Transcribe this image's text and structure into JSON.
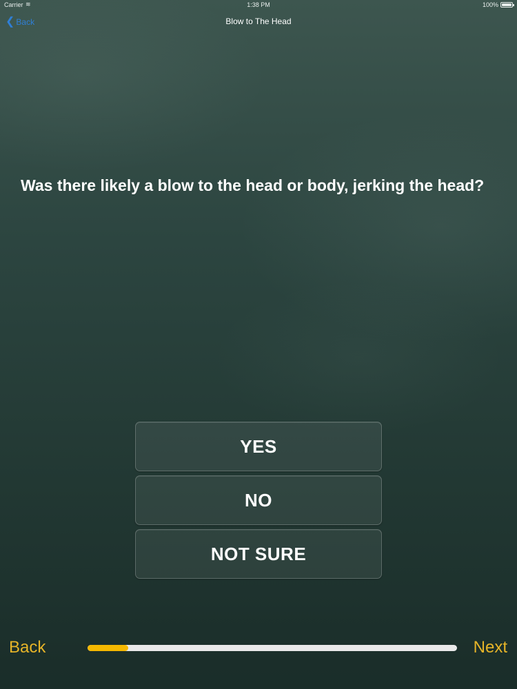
{
  "status_bar": {
    "carrier": "Carrier",
    "wifi_icon": "wifi-icon",
    "time": "1:38 PM",
    "battery_level": "100%",
    "battery_icon": "battery-icon"
  },
  "nav": {
    "back_label": "Back",
    "back_icon": "chevron-left-icon",
    "title": "Blow to The Head",
    "accent_color": "#2f7fd6"
  },
  "question": {
    "text": "Was there likely a blow to the head or body, jerking the head?"
  },
  "answers": {
    "yes": "YES",
    "no": "NO",
    "not_sure": "NOT SURE"
  },
  "footer": {
    "back_label": "Back",
    "next_label": "Next",
    "progress_fraction": 0.11,
    "progress_color": "#f5b800",
    "link_color": "#e6b428"
  }
}
